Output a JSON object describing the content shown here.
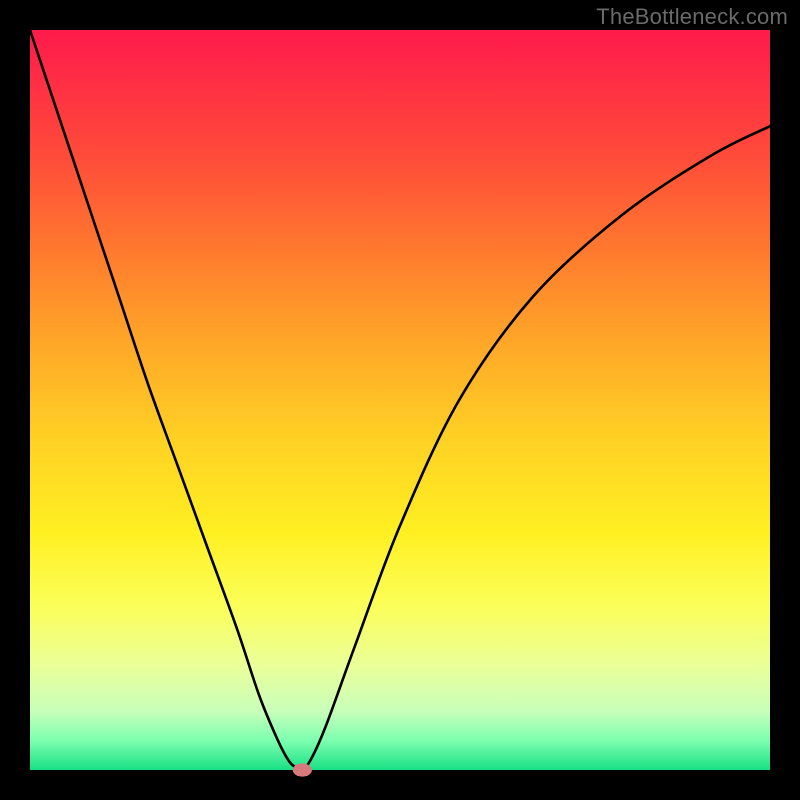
{
  "watermark": "TheBottleneck.com",
  "chart_data": {
    "type": "line",
    "title": "",
    "xlabel": "",
    "ylabel": "",
    "xlim": [
      0,
      100
    ],
    "ylim": [
      0,
      100
    ],
    "grid": false,
    "legend": false,
    "series": [
      {
        "name": "bottleneck-curve",
        "x": [
          0,
          4,
          8,
          12,
          16,
          20,
          24,
          28,
          31,
          33.5,
          35,
          36,
          36.8,
          38,
          40,
          44,
          50,
          58,
          68,
          80,
          92,
          100
        ],
        "y": [
          100,
          88,
          76,
          64,
          52,
          41,
          30,
          19,
          10,
          4,
          1.2,
          0.3,
          0.0,
          1.5,
          6,
          17,
          33,
          50,
          64,
          75,
          83,
          87
        ]
      }
    ],
    "marker": {
      "x": 36.8,
      "y": 0.0,
      "rx": 1.3,
      "ry": 0.9
    },
    "min_point": {
      "x": 36.8,
      "y": 0.0
    }
  },
  "colors": {
    "frame": "#000000",
    "watermark": "#6a6a6a",
    "curve": "#000000",
    "marker": "#d77a7d"
  }
}
